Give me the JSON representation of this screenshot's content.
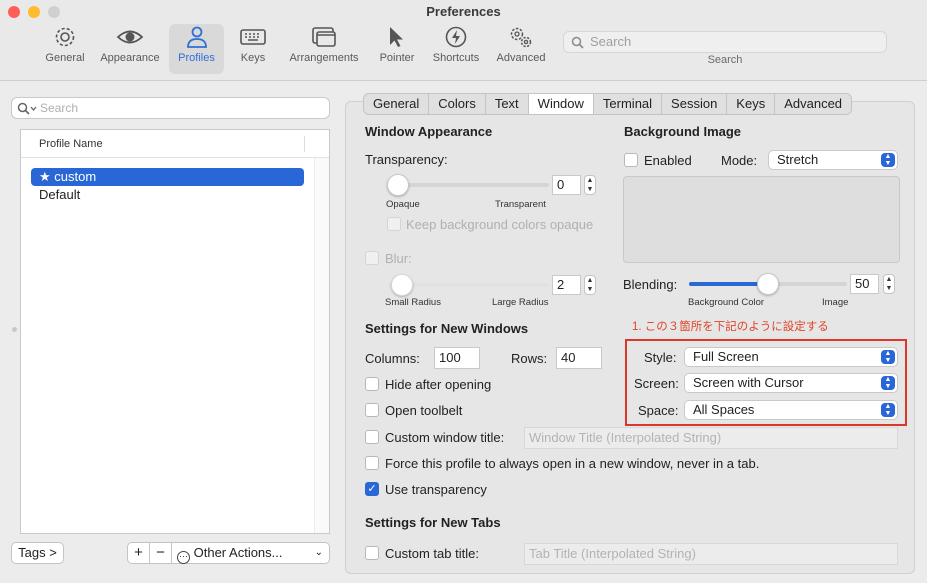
{
  "window": {
    "title": "Preferences"
  },
  "toolbar": {
    "items": [
      {
        "label": "General",
        "icon": "gear-icon"
      },
      {
        "label": "Appearance",
        "icon": "eye-icon"
      },
      {
        "label": "Profiles",
        "icon": "person-icon"
      },
      {
        "label": "Keys",
        "icon": "keyboard-icon"
      },
      {
        "label": "Arrangements",
        "icon": "windows-icon"
      },
      {
        "label": "Pointer",
        "icon": "pointer-icon"
      },
      {
        "label": "Shortcuts",
        "icon": "lightning-icon"
      },
      {
        "label": "Advanced",
        "icon": "gears-icon"
      }
    ],
    "search_placeholder": "Search",
    "search_label": "Search"
  },
  "left": {
    "search_placeholder": "Search",
    "column_header": "Profile Name",
    "profiles": [
      "custom",
      "Default"
    ],
    "tags_button": "Tags >",
    "add_button": "+",
    "remove_button": "−",
    "other_actions": "Other Actions..."
  },
  "tabs": [
    "General",
    "Colors",
    "Text",
    "Window",
    "Terminal",
    "Session",
    "Keys",
    "Advanced"
  ],
  "window_appearance": {
    "heading": "Window Appearance",
    "transparency_label": "Transparency:",
    "transparency_value": "0",
    "opaque_label": "Opaque",
    "transparent_label": "Transparent",
    "keep_bg_label": "Keep background colors opaque",
    "blur_label": "Blur:",
    "blur_value": "2",
    "small_radius": "Small Radius",
    "large_radius": "Large Radius"
  },
  "background_image": {
    "heading": "Background Image",
    "enabled_label": "Enabled",
    "mode_label": "Mode:",
    "mode_value": "Stretch",
    "blending_label": "Blending:",
    "blending_value": "50",
    "blending_fraction": 0.5,
    "bg_color_label": "Background Color",
    "image_label": "Image"
  },
  "new_windows": {
    "heading": "Settings for New Windows",
    "columns_label": "Columns:",
    "columns_value": "100",
    "rows_label": "Rows:",
    "rows_value": "40",
    "hide_after_opening": "Hide after opening",
    "open_toolbelt": "Open toolbelt",
    "custom_title_label": "Custom window title:",
    "custom_title_placeholder": "Window Title (Interpolated String)",
    "force_new_window": "Force this profile to always open in a new window, never in a tab.",
    "use_transparency": "Use transparency",
    "style_label": "Style:",
    "style_value": "Full Screen",
    "screen_label": "Screen:",
    "screen_value": "Screen with Cursor",
    "space_label": "Space:",
    "space_value": "All Spaces"
  },
  "annotation": {
    "text": "1. この３箇所を下記のように設定する",
    "color": "#e0442a"
  },
  "new_tabs": {
    "heading": "Settings for New Tabs",
    "custom_tab_title_label": "Custom tab title:",
    "custom_tab_title_placeholder": "Tab Title (Interpolated String)"
  },
  "colors": {
    "accent": "#2a67d6",
    "close": "#ff5f57",
    "minimize": "#febc2e",
    "zoom": "#d0d0d0"
  }
}
